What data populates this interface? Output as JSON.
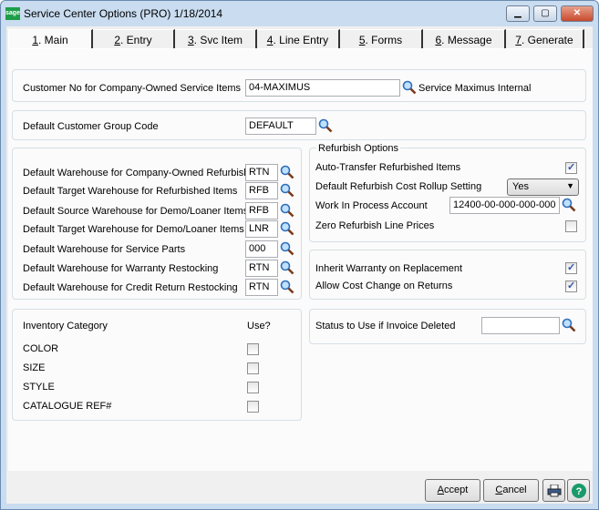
{
  "window": {
    "title": "Service Center Options (PRO) 1/18/2014",
    "logo": "sage",
    "minimize": "minimize-icon",
    "maximize": "maximize-icon",
    "close": "close-icon"
  },
  "tabs": [
    {
      "key": "1",
      "label": ". Main"
    },
    {
      "key": "2",
      "label": ". Entry"
    },
    {
      "key": "3",
      "label": ". Svc Item Entry"
    },
    {
      "key": "4",
      "label": ". Line Entry"
    },
    {
      "key": "5",
      "label": ". Forms"
    },
    {
      "key": "6",
      "label": ". Message"
    },
    {
      "key": "7",
      "label": ". Generate PO"
    }
  ],
  "customer": {
    "label": "Customer No for Company-Owned Service Items",
    "value": "04-MAXIMUS",
    "description": "Service Maximus Internal"
  },
  "group": {
    "label": "Default Customer Group Code",
    "value": "DEFAULT"
  },
  "warehouses": [
    {
      "label": "Default Warehouse for Company-Owned Refurbish",
      "value": "RTN"
    },
    {
      "label": "Default Target Warehouse for Refurbished Items",
      "value": "RFB"
    },
    {
      "label": "Default Source Warehouse for Demo/Loaner Items",
      "value": "RFB"
    },
    {
      "label": "Default Target Warehouse for Demo/Loaner Items",
      "value": "LNR"
    },
    {
      "label": "Default Warehouse for Service Parts",
      "value": "000"
    },
    {
      "label": "Default Warehouse for Warranty Restocking",
      "value": "RTN"
    },
    {
      "label": "Default Warehouse for Credit Return Restocking",
      "value": "RTN"
    }
  ],
  "refurbish": {
    "legend": "Refurbish Options",
    "auto_transfer": {
      "label": "Auto-Transfer Refurbished Items",
      "checked": true
    },
    "rollup": {
      "label": "Default Refurbish Cost Rollup Setting",
      "value": "Yes"
    },
    "wip": {
      "label": "Work In Process Account",
      "value": "12400-00-000-000-000"
    },
    "zero_prices": {
      "label": "Zero Refurbish Line Prices",
      "checked": false
    }
  },
  "warranty": {
    "inherit": {
      "label": "Inherit Warranty on Replacement",
      "checked": true
    },
    "cost_change": {
      "label": "Allow Cost Change on Returns",
      "checked": true
    }
  },
  "inventory": {
    "header": "Inventory Category",
    "use_header": "Use?",
    "items": [
      {
        "label": "COLOR",
        "checked": false
      },
      {
        "label": "SIZE",
        "checked": false
      },
      {
        "label": "STYLE",
        "checked": false
      },
      {
        "label": "CATALOGUE REF#",
        "checked": false
      }
    ]
  },
  "status": {
    "label": "Status to Use if Invoice Deleted",
    "value": ""
  },
  "buttons": {
    "accept_key": "A",
    "accept_rest": "ccept",
    "cancel_key": "C",
    "cancel_rest": "ancel",
    "print": "printer-icon",
    "help": "help-icon"
  }
}
